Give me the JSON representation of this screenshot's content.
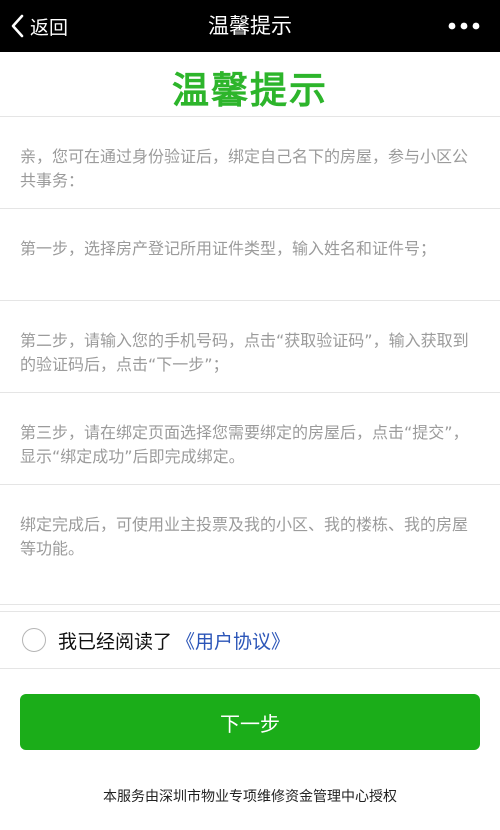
{
  "navbar": {
    "back_label": "返回",
    "title": "温馨提示",
    "back_icon": "chevron-left-icon",
    "more_icon": "more-dots-icon"
  },
  "heading": "温馨提示",
  "notices": [
    "亲，您可在通过身份验证后，绑定自己名下的房屋，参与小区公共事务：",
    "第一步，选择房产登记所用证件类型，输入姓名和证件号；",
    "第二步，请输入您的手机号码，点击“获取验证码”，输入获取到的验证码后，点击“下一步”；",
    "第三步，请在绑定页面选择您需要绑定的房屋后，点击“提交”，显示“绑定成功”后即完成绑定。",
    "绑定完成后，可使用业主投票及我的小区、我的楼栋、我的房屋等功能。"
  ],
  "agreement": {
    "checked": false,
    "text": "我已经阅读了",
    "link": "《用户协议》"
  },
  "next_button": "下一步",
  "footer": "本服务由深圳市物业专项维修资金管理中心授权",
  "colors": {
    "navbar_bg": "#000000",
    "heading": "#2db52b",
    "button_bg": "#1bad19",
    "link": "#2b55b8",
    "notice_text": "#9b9b9b"
  }
}
